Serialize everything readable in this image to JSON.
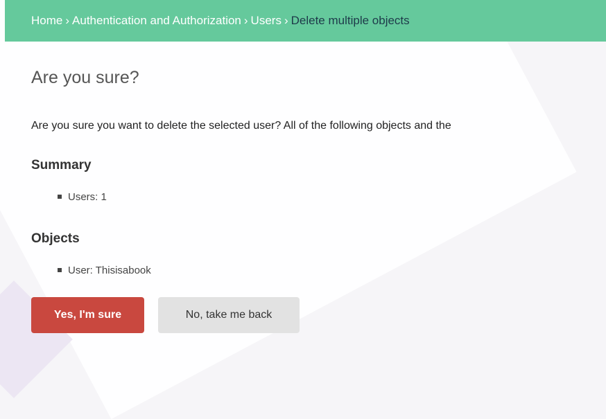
{
  "breadcrumbs": {
    "home": "Home",
    "separator": "›",
    "app": "Authentication and Authorization",
    "model": "Users",
    "current": "Delete multiple objects"
  },
  "page": {
    "title": "Are you sure?",
    "warning": "Are you sure you want to delete the selected user? All of the following objects and the"
  },
  "summary": {
    "heading": "Summary",
    "items": [
      "Users: 1"
    ]
  },
  "objects": {
    "heading": "Objects",
    "items": [
      "User: Thisisabook"
    ]
  },
  "actions": {
    "confirm_label": "Yes, I'm sure",
    "cancel_label": "No, take me back"
  },
  "colors": {
    "breadcrumb_bg": "#65c99c",
    "confirm_bg": "#c9483f",
    "cancel_bg": "#e2e2e2"
  }
}
